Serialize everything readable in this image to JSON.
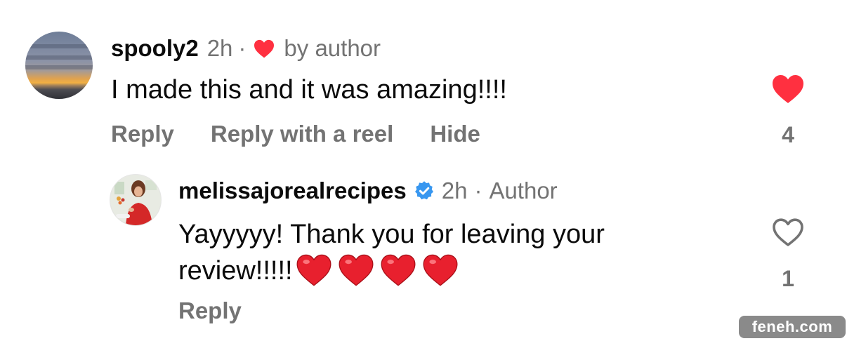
{
  "comment1": {
    "username": "spooly2",
    "time": "2h",
    "separator": "·",
    "liked_by": "by author",
    "text": "I made this and it was amazing!!!!",
    "actions": {
      "reply": "Reply",
      "reply_reel": "Reply with a reel",
      "hide": "Hide"
    },
    "likes": "4",
    "liked": true
  },
  "comment2": {
    "username": "melissajorealrecipes",
    "time": "2h",
    "separator": "·",
    "role": "Author",
    "text": "Yayyyyy! Thank you for leaving your review!!!!!",
    "emoji": [
      "red-heart",
      "red-heart",
      "red-heart",
      "red-heart"
    ],
    "actions": {
      "reply": "Reply"
    },
    "likes": "1",
    "liked": false
  },
  "colors": {
    "like_red": "#ff3040",
    "verified_blue": "#3897f0",
    "muted": "#737373"
  },
  "watermark": "feneh.com"
}
